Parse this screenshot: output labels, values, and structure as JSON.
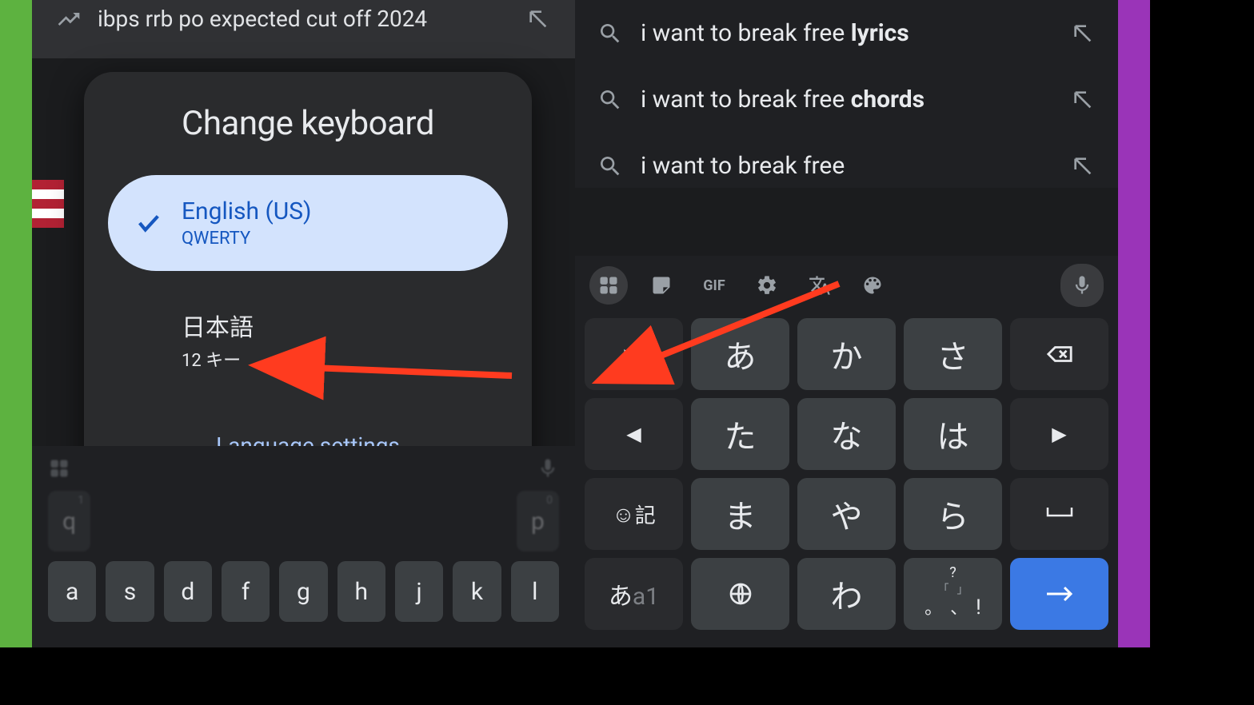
{
  "left": {
    "suggestion_top": "ibps rrb po expected cut off 2024",
    "dialog_title": "Change keyboard",
    "options": [
      {
        "name": "English (US)",
        "layout": "QWERTY"
      },
      {
        "name": "日本語",
        "layout": "12 キー"
      }
    ],
    "language_settings": "Language settings",
    "row1": [
      "q",
      "p"
    ],
    "row1_sup": [
      "1",
      "0"
    ],
    "row2": [
      "a",
      "s",
      "d",
      "f",
      "g",
      "h",
      "j",
      "k",
      "l"
    ]
  },
  "right": {
    "suggestions": [
      {
        "prefix": "i want to break free ",
        "bold": "lyrics"
      },
      {
        "prefix": "i want to break free ",
        "bold": "chords"
      },
      {
        "prefix": "i want to break free",
        "bold": ""
      }
    ],
    "toolbar_gif": "GIF",
    "keys": {
      "r1": [
        "あ",
        "か",
        "さ"
      ],
      "r2": [
        "た",
        "な",
        "は"
      ],
      "r3_emoji": "記",
      "r3": [
        "ま",
        "や",
        "ら"
      ],
      "r4_mode": "あa1",
      "r4": [
        "わ"
      ]
    }
  }
}
